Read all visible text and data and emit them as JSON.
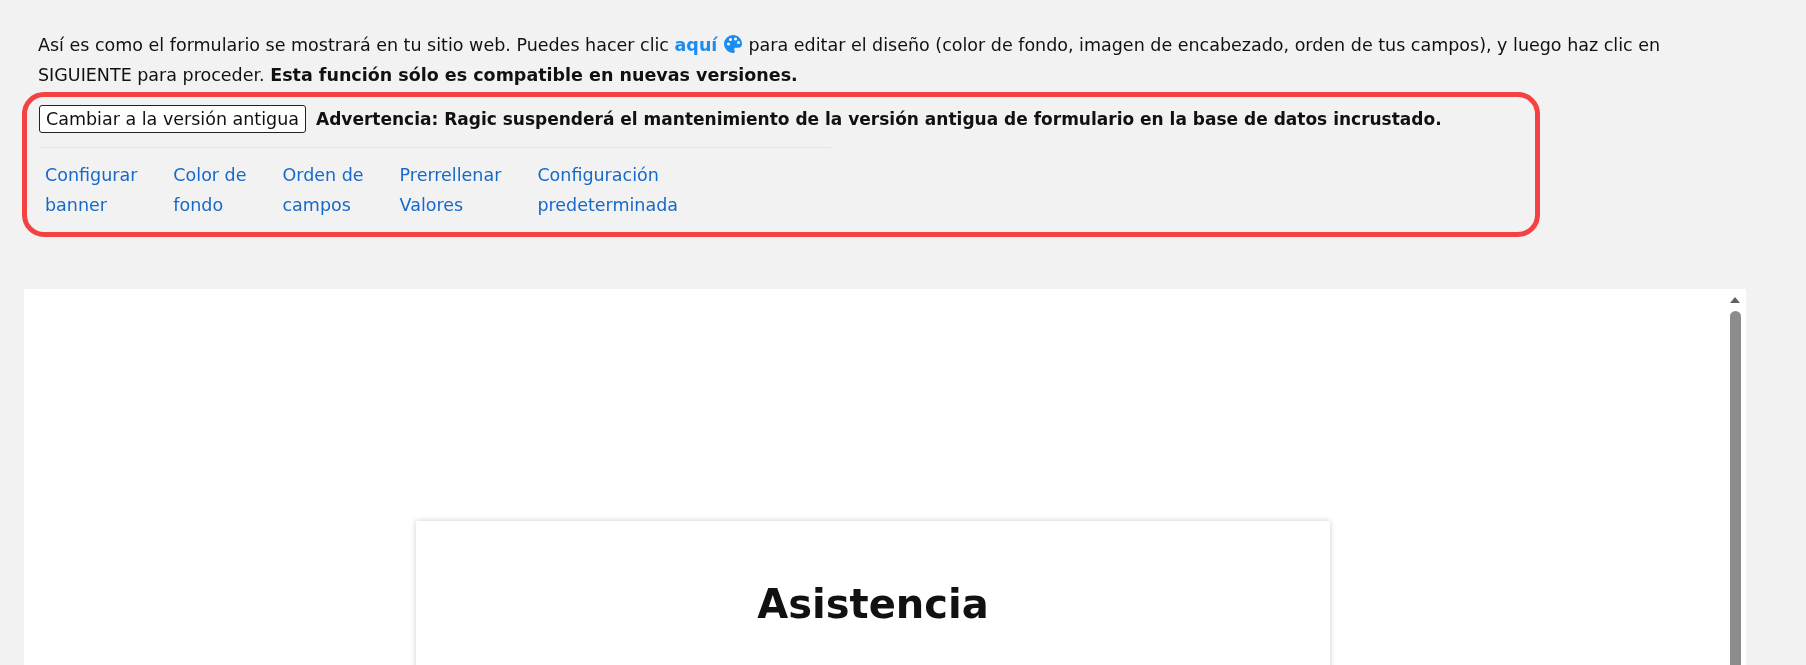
{
  "intro": {
    "before": "Así es como el formulario se mostrará en tu sitio web. Puedes hacer clic",
    "link": "aquí",
    "after": "para editar el diseño (color de fondo, imagen de encabezado, orden de tus campos), y luego haz clic en SIGUIENTE para proceder.",
    "note": "Esta función sólo es compatible en nuevas versiones."
  },
  "switch_button": "Cambiar a la versión antigua",
  "warning": "Advertencia: Ragic suspenderá el mantenimiento de la versión antigua de formulario en la base de datos incrustado.",
  "settings_links": [
    {
      "label": "Configurar\nbanner"
    },
    {
      "label": "Color de\nfondo"
    },
    {
      "label": "Orden de\ncampos"
    },
    {
      "label": "Prerrellenar\nValores"
    },
    {
      "label": "Configuración\npredeterminada"
    }
  ],
  "preview": {
    "form_title": "Asistencia"
  }
}
